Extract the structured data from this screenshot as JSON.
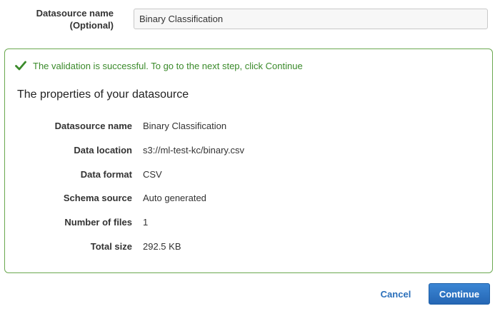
{
  "datasource_name_field": {
    "label_line1": "Datasource name",
    "label_line2": "(Optional)",
    "value": "Binary Classification"
  },
  "validation": {
    "icon": "checkmark-icon",
    "message": "The validation is successful. To go to the next step, click Continue",
    "color": "#3a8a2a"
  },
  "properties": {
    "title": "The properties of your datasource",
    "rows": [
      {
        "label": "Datasource name",
        "value": "Binary Classification"
      },
      {
        "label": "Data location",
        "value": "s3://ml-test-kc/binary.csv"
      },
      {
        "label": "Data format",
        "value": "CSV"
      },
      {
        "label": "Schema source",
        "value": "Auto generated"
      },
      {
        "label": "Number of files",
        "value": "1"
      },
      {
        "label": "Total size",
        "value": "292.5 KB"
      }
    ]
  },
  "actions": {
    "cancel_label": "Cancel",
    "continue_label": "Continue",
    "primary_color": "#2a6fba"
  }
}
